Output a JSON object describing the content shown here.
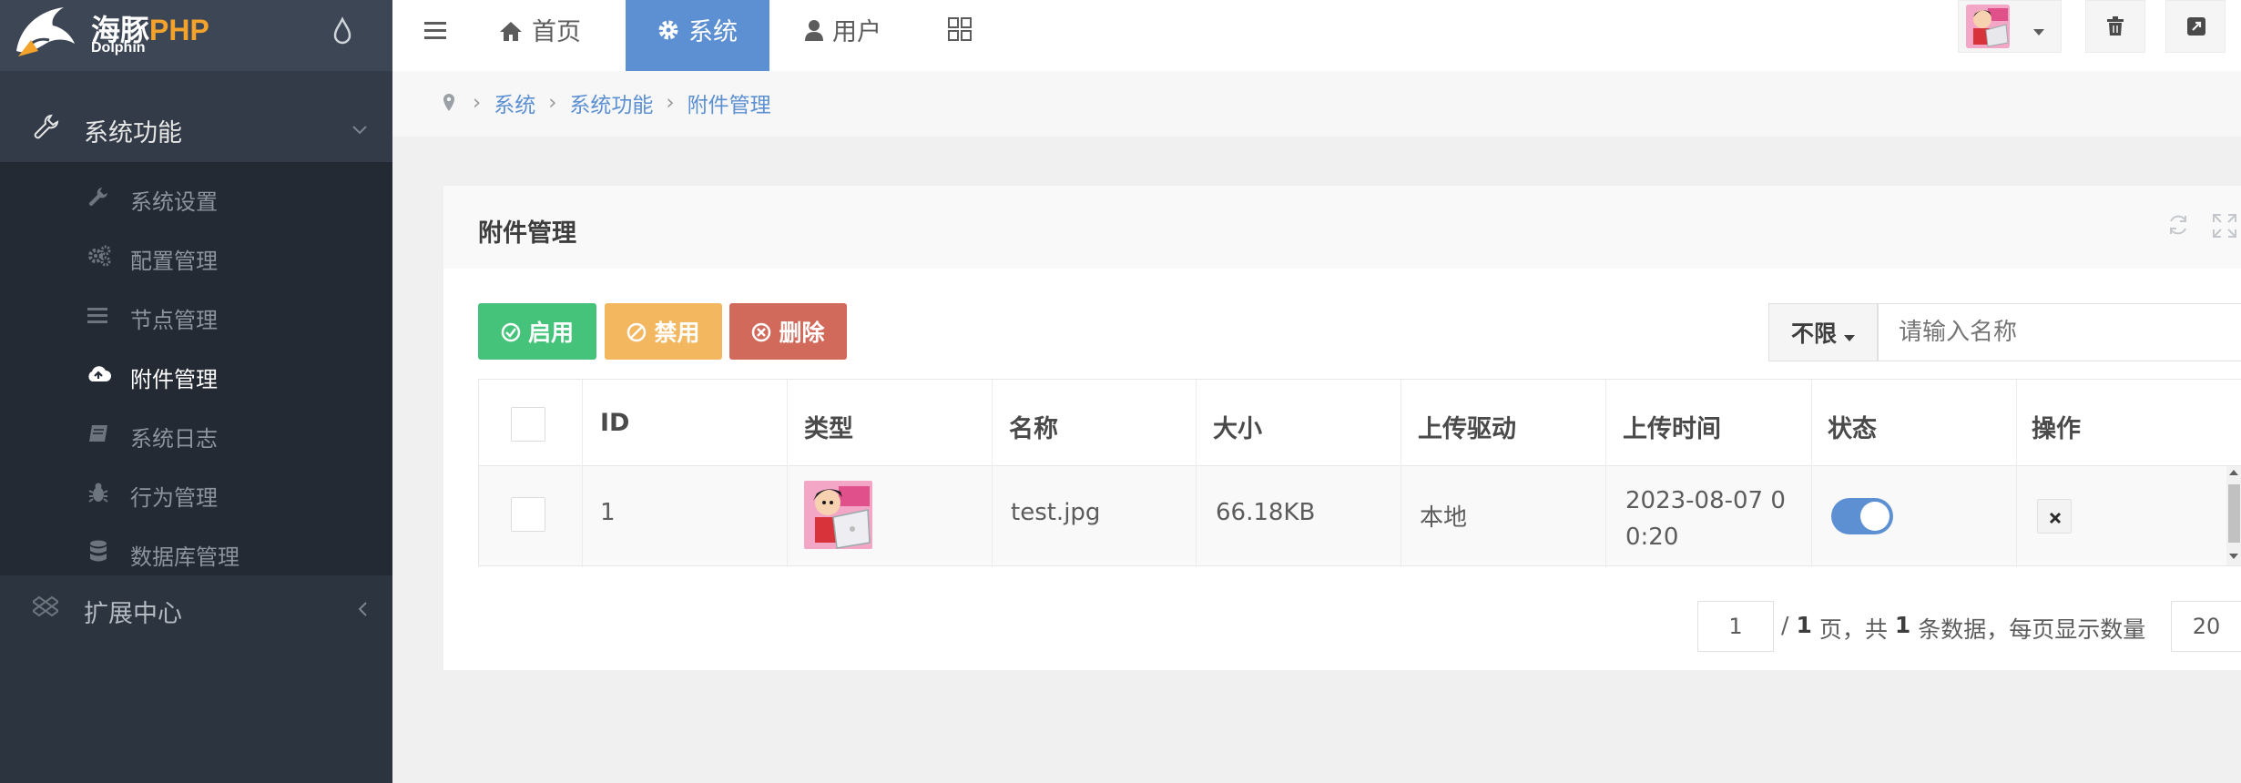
{
  "brand": {
    "cn": "海豚",
    "php": "PHP",
    "sub": "Dolphin"
  },
  "top_nav": {
    "home": "首页",
    "system": "系统",
    "user": "用户"
  },
  "sidebar": {
    "group1": "系统功能",
    "items": [
      {
        "label": "系统设置",
        "icon": "wrench-icon"
      },
      {
        "label": "配置管理",
        "icon": "gears-icon"
      },
      {
        "label": "节点管理",
        "icon": "list-icon"
      },
      {
        "label": "附件管理",
        "icon": "cloud-upload-icon"
      },
      {
        "label": "系统日志",
        "icon": "book-icon"
      },
      {
        "label": "行为管理",
        "icon": "bug-icon"
      },
      {
        "label": "数据库管理",
        "icon": "database-icon"
      }
    ],
    "group2": "扩展中心"
  },
  "breadcrumb": [
    "系统",
    "系统功能",
    "附件管理"
  ],
  "card": {
    "title": "附件管理",
    "buttons": {
      "enable": "启用",
      "disable": "禁用",
      "delete": "删除"
    },
    "filter": {
      "label": "不限",
      "placeholder": "请输入名称"
    }
  },
  "table": {
    "headers": [
      "ID",
      "类型",
      "名称",
      "大小",
      "上传驱动",
      "上传时间",
      "状态",
      "操作"
    ],
    "rows": [
      {
        "id": "1",
        "name": "test.jpg",
        "size": "66.18KB",
        "driver": "本地",
        "time_line1": "2023-08-07 0",
        "time_line2": "0:20",
        "status_on": true
      }
    ]
  },
  "pagination": {
    "page": "1",
    "sep": "/",
    "total_pages": "1",
    "t1": "页，共",
    "count": "1",
    "t2": "条数据，每页显示数量",
    "per_page": "20"
  },
  "colors": {
    "primary": "#5c90d2",
    "success": "#46c37b",
    "warning": "#f3b760",
    "danger": "#d26a5c",
    "sidebar": "#2c343f"
  }
}
